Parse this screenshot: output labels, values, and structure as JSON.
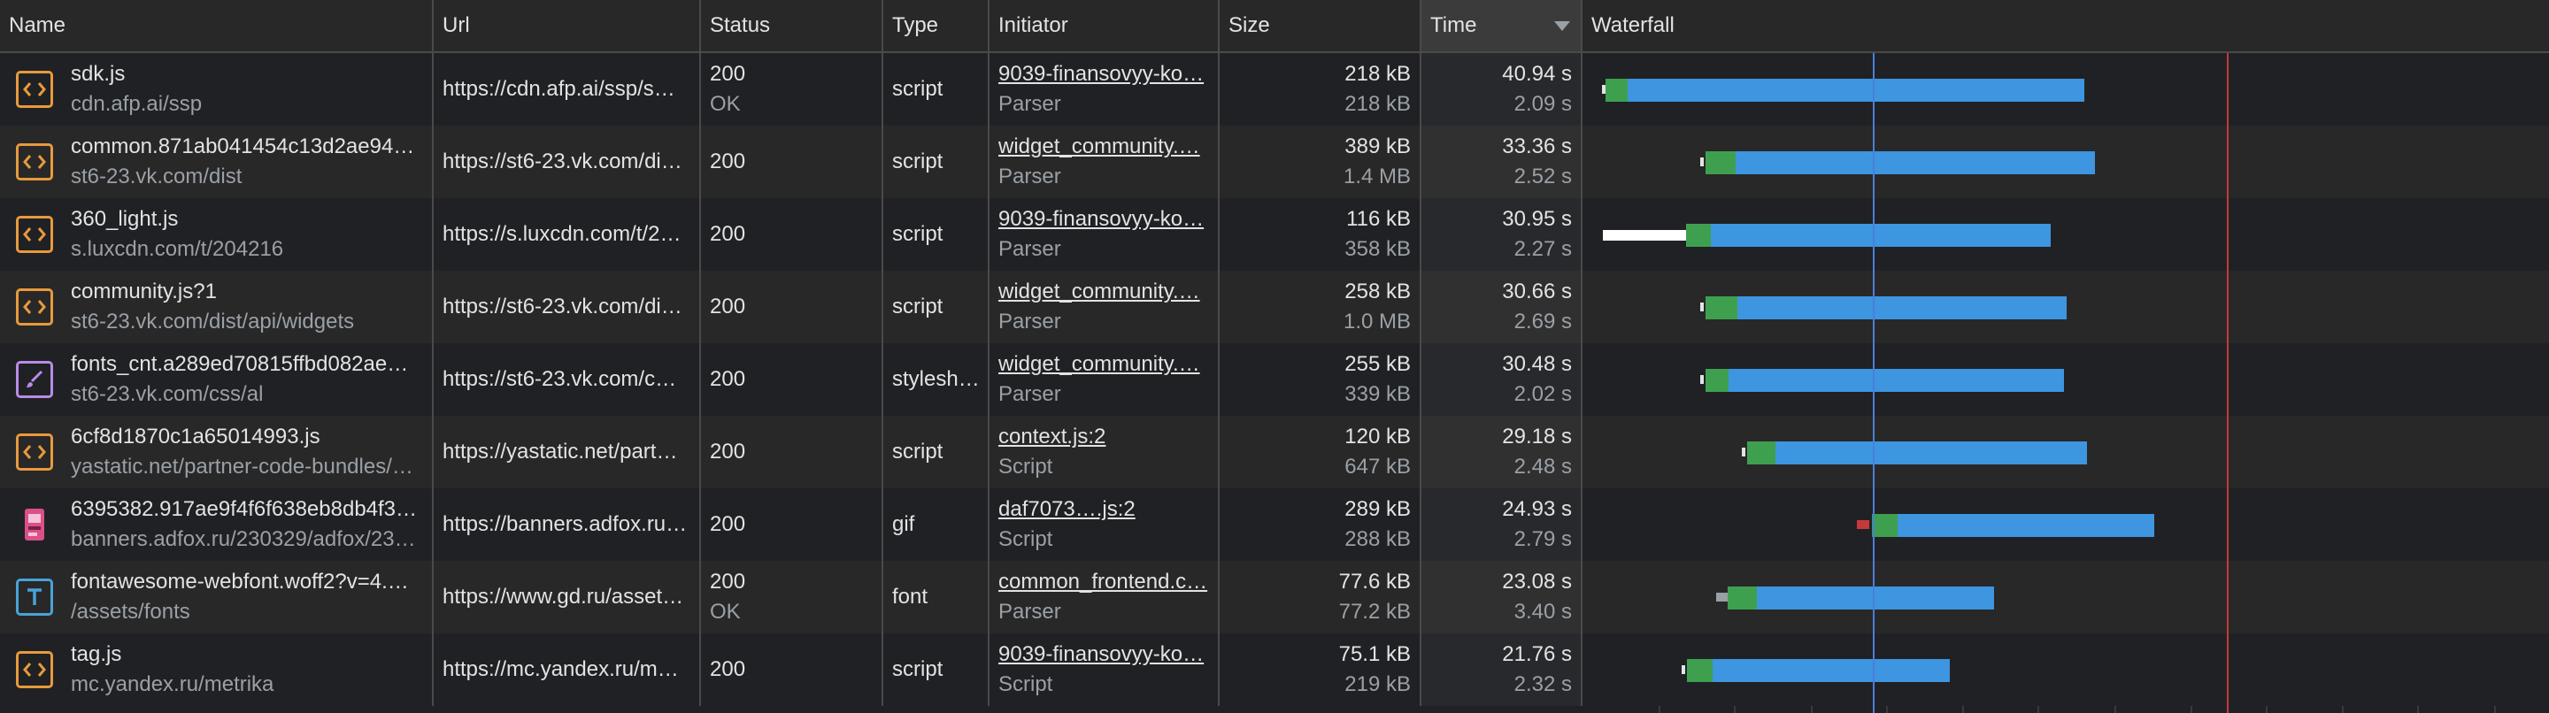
{
  "columns": [
    {
      "key": "name",
      "label": "Name"
    },
    {
      "key": "url",
      "label": "Url"
    },
    {
      "key": "status",
      "label": "Status"
    },
    {
      "key": "type",
      "label": "Type"
    },
    {
      "key": "initiator",
      "label": "Initiator"
    },
    {
      "key": "size",
      "label": "Size"
    },
    {
      "key": "time",
      "label": "Time",
      "sorted": true
    },
    {
      "key": "waterfall",
      "label": "Waterfall"
    }
  ],
  "colors": {
    "green": "#3ea04f",
    "blue": "#3e95e0",
    "dom_content_line": "#4a7fd8",
    "load_line": "#c43a3a",
    "script_icon": "#e89a3c",
    "stylesheet_icon": "#b98ce8",
    "font_icon": "#48a3d8"
  },
  "rows": [
    {
      "name": "sdk.js",
      "domain": "cdn.afp.ai/ssp",
      "url": "https://cdn.afp.ai/ssp/s…",
      "status": "200",
      "status_text": "OK",
      "type": "script",
      "icon": "script-icon",
      "initiator": "9039-finansovyy-ko…",
      "initiator_sub": "Parser",
      "size": "218 kB",
      "size_sub": "218 kB",
      "time": "40.94 s",
      "time_sub": "2.09 s",
      "wf": {
        "queue_start": 0.02,
        "queue_end": 0.024,
        "wait_start": 0.024,
        "wait_end": 0.047,
        "dl_end": 0.519,
        "queue_color": "#e3e3e3"
      }
    },
    {
      "name": "common.871ab041454c13d2ae94…",
      "domain": "st6-23.vk.com/dist",
      "url": "https://st6-23.vk.com/di…",
      "status": "200",
      "status_text": "",
      "type": "script",
      "icon": "script-icon",
      "initiator": "widget_community.…",
      "initiator_sub": "Parser",
      "size": "389 kB",
      "size_sub": "1.4 MB",
      "time": "33.36 s",
      "time_sub": "2.52 s",
      "wf": {
        "queue_start": 0.122,
        "queue_end": 0.125,
        "wait_start": 0.127,
        "wait_end": 0.158,
        "dl_end": 0.53,
        "queue_color": "#e3e3e3"
      }
    },
    {
      "name": "360_light.js",
      "domain": "s.luxcdn.com/t/204216",
      "url": "https://s.luxcdn.com/t/2…",
      "status": "200",
      "status_text": "",
      "type": "script",
      "icon": "script-icon",
      "initiator": "9039-finansovyy-ko…",
      "initiator_sub": "Parser",
      "size": "116 kB",
      "size_sub": "358 kB",
      "time": "30.95 s",
      "time_sub": "2.27 s",
      "wf": {
        "queue_start": 0.021,
        "queue_end": 0.107,
        "wait_start": 0.107,
        "wait_end": 0.133,
        "dl_end": 0.484,
        "queue_color": "#ffffff"
      }
    },
    {
      "name": "community.js?1",
      "domain": "st6-23.vk.com/dist/api/widgets",
      "url": "https://st6-23.vk.com/di…",
      "status": "200",
      "status_text": "",
      "type": "script",
      "icon": "script-icon",
      "initiator": "widget_community.…",
      "initiator_sub": "Parser",
      "size": "258 kB",
      "size_sub": "1.0 MB",
      "time": "30.66 s",
      "time_sub": "2.69 s",
      "wf": {
        "queue_start": 0.122,
        "queue_end": 0.125,
        "wait_start": 0.127,
        "wait_end": 0.16,
        "dl_end": 0.501,
        "queue_color": "#e3e3e3"
      }
    },
    {
      "name": "fonts_cnt.a289ed70815ffbd082ae…",
      "domain": "st6-23.vk.com/css/al",
      "url": "https://st6-23.vk.com/c…",
      "status": "200",
      "status_text": "",
      "type": "stylesh…",
      "icon": "stylesheet-icon",
      "initiator": "widget_community.…",
      "initiator_sub": "Parser",
      "size": "255 kB",
      "size_sub": "339 kB",
      "time": "30.48 s",
      "time_sub": "2.02 s",
      "wf": {
        "queue_start": 0.122,
        "queue_end": 0.125,
        "wait_start": 0.127,
        "wait_end": 0.151,
        "dl_end": 0.498,
        "queue_color": "#e3e3e3"
      }
    },
    {
      "name": "6cf8d1870c1a65014993.js",
      "domain": "yastatic.net/partner-code-bundles/…",
      "url": "https://yastatic.net/part…",
      "status": "200",
      "status_text": "",
      "type": "script",
      "icon": "script-icon",
      "initiator": "context.js:2",
      "initiator_sub": "Script",
      "size": "120 kB",
      "size_sub": "647 kB",
      "time": "29.18 s",
      "time_sub": "2.48 s",
      "wf": {
        "queue_start": 0.165,
        "queue_end": 0.168,
        "wait_start": 0.17,
        "wait_end": 0.2,
        "dl_end": 0.522,
        "queue_color": "#e3e3e3"
      }
    },
    {
      "name": "6395382.917ae9f4f6f638eb8db4f3…",
      "domain": "banners.adfox.ru/230329/adfox/23…",
      "url": "https://banners.adfox.ru…",
      "status": "200",
      "status_text": "",
      "type": "gif",
      "icon": "image-icon",
      "initiator": "daf7073….js:2",
      "initiator_sub": "Script",
      "size": "289 kB",
      "size_sub": "288 kB",
      "time": "24.93 s",
      "time_sub": "2.79 s",
      "wf": {
        "queue_start": 0.284,
        "queue_end": 0.297,
        "wait_start": 0.299,
        "wait_end": 0.326,
        "dl_end": 0.592,
        "queue_color": "#c43a3a"
      }
    },
    {
      "name": "fontawesome-webfont.woff2?v=4.…",
      "domain": "/assets/fonts",
      "url": "https://www.gd.ru/asset…",
      "status": "200",
      "status_text": "OK",
      "type": "font",
      "icon": "font-icon",
      "initiator": "common_frontend.c…",
      "initiator_sub": "Parser",
      "size": "77.6 kB",
      "size_sub": "77.2 kB",
      "time": "23.08 s",
      "time_sub": "3.40 s",
      "wf": {
        "queue_start": 0.138,
        "queue_end": 0.15,
        "wait_start": 0.15,
        "wait_end": 0.18,
        "dl_end": 0.426,
        "queue_color": "#9aa0a6"
      }
    },
    {
      "name": "tag.js",
      "domain": "mc.yandex.ru/metrika",
      "url": "https://mc.yandex.ru/m…",
      "status": "200",
      "status_text": "",
      "type": "script",
      "icon": "script-icon",
      "initiator": "9039-finansovyy-ko…",
      "initiator_sub": "Script",
      "size": "75.1 kB",
      "size_sub": "219 kB",
      "time": "21.76 s",
      "time_sub": "2.32 s",
      "wf": {
        "queue_start": 0.103,
        "queue_end": 0.106,
        "wait_start": 0.108,
        "wait_end": 0.135,
        "dl_end": 0.38,
        "queue_color": "#e3e3e3"
      }
    }
  ]
}
